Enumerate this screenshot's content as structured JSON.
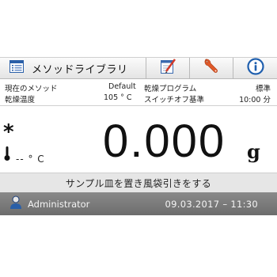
{
  "toolbar": {
    "method_label": "メソッドライブラリ",
    "icons": [
      "method-library-icon",
      "edit-icon",
      "wrench-icon",
      "info-icon"
    ]
  },
  "info": {
    "current_method_label": "現在のメソッド",
    "current_method_value": "Default",
    "drying_program_label": "乾燥プログラム",
    "drying_program_value": "標準",
    "drying_temp_label": "乾燥温度",
    "drying_temp_value": "105 ° C",
    "switchoff_label": "スイッチオフ基準",
    "switchoff_value": "10:00 分"
  },
  "reading": {
    "stability_mark": "*",
    "temperature": "-- ° C",
    "weight": "0.000",
    "unit": "g"
  },
  "instruction": "サンプル皿を置き風袋引きをする",
  "status": {
    "user": "Administrator",
    "datetime": "09.03.2017 – 11:30"
  },
  "colors": {
    "status_bar": "#7a7a7a",
    "instruction_bar": "#e6e6e6",
    "info_icon": "#1f5fae",
    "wrench_icon": "#e05a2a"
  }
}
